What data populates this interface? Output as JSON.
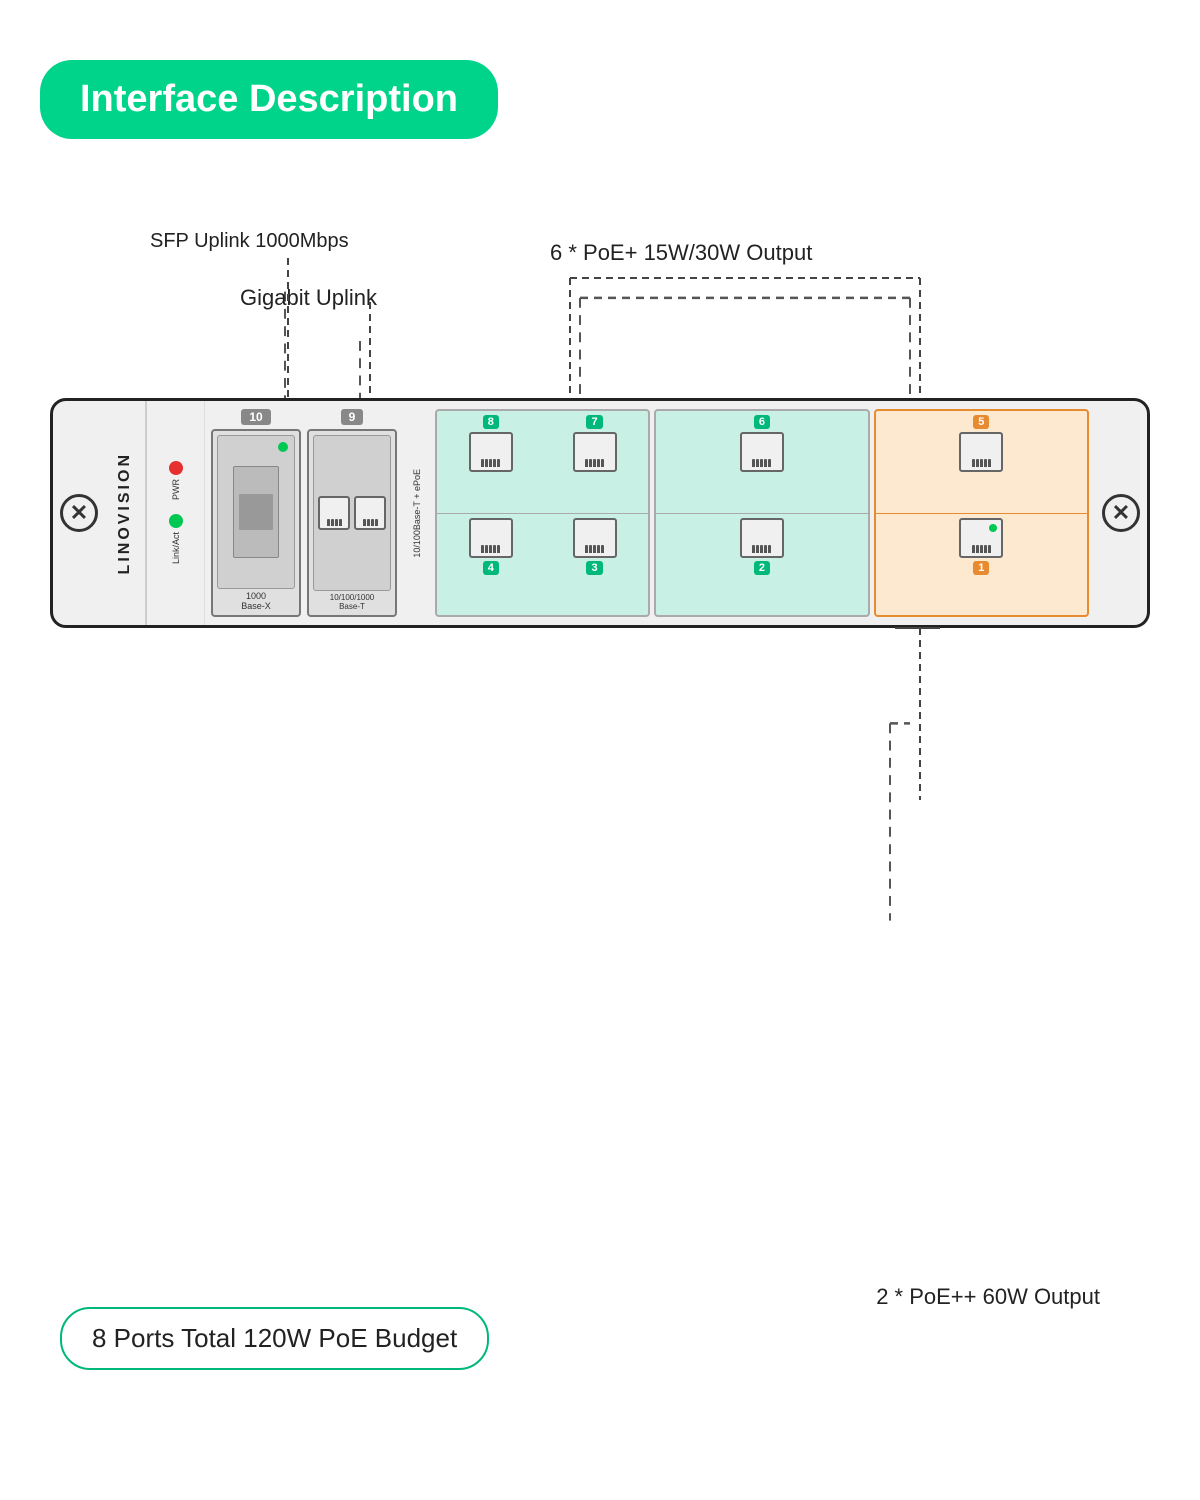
{
  "header": {
    "title": "Interface Description",
    "bg_color": "#00d48a"
  },
  "labels": {
    "sfp_uplink": "SFP Uplink 1000Mbps",
    "gigabit_uplink": "Gigabit Uplink",
    "poe_plus_output": "6 * PoE+ 15W/30W Output",
    "poe_plusplus_output": "2 * PoE++ 60W Output",
    "budget": "8 Ports Total 120W PoE Budget"
  },
  "device": {
    "brand": "LINOVISION",
    "ports": {
      "sfp": {
        "label": "1000 Base-X",
        "number": "10"
      },
      "rj45_uplink": {
        "label": "10/100/1000 Base-T",
        "number": "9"
      },
      "epoe_label": "10/100Base-T + ePoE",
      "poe_ports_top": [
        "8",
        "7",
        "6",
        "5"
      ],
      "poe_ports_bottom": [
        "4",
        "3",
        "2",
        "1"
      ]
    },
    "leds": [
      {
        "label": "PWR",
        "color": "red"
      },
      {
        "label": "Link/Act",
        "color": "green"
      }
    ]
  },
  "icons": {
    "screw": "✕",
    "left_screw": "✕",
    "right_screw": "✕"
  }
}
